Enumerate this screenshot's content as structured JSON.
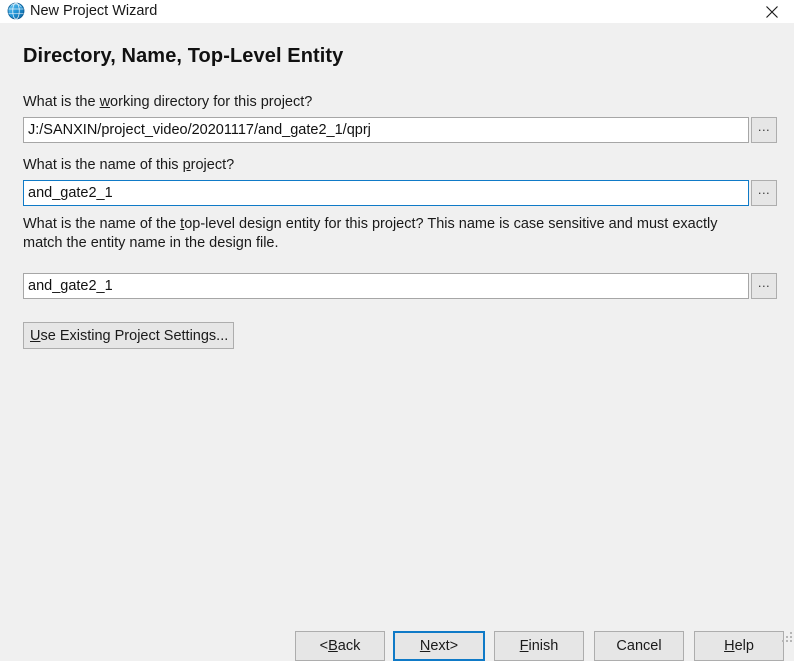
{
  "window": {
    "title": "New Project Wizard",
    "icon": "globe-icon",
    "close_label": "×",
    "accent_color": "#0f7ac7",
    "titlebar_bg": "#ffffff",
    "body_bg": "#f0f0f0"
  },
  "page": {
    "heading": "Directory, Name, Top-Level Entity"
  },
  "fields": {
    "working_directory": {
      "label_before": "What is the ",
      "label_mnemonic": "w",
      "label_after": "orking directory for this project?",
      "value": "J:/SANXIN/project_video/20201117/and_gate2_1/qprj",
      "browse_label": "...",
      "focused": false
    },
    "project_name": {
      "label_before": "What is the name of this ",
      "label_mnemonic": "p",
      "label_after": "roject?",
      "value": "and_gate2_1",
      "browse_label": "...",
      "focused": true
    },
    "top_level_entity": {
      "label_before": "What is the name of the ",
      "label_mnemonic": "t",
      "label_after": "op-level design entity for this project? This name is case sensitive and must exactly",
      "label_line2": "match the entity name in the design file.",
      "value": "and_gate2_1",
      "browse_label": "...",
      "focused": false
    }
  },
  "use_existing": {
    "mnemonic": "U",
    "rest": "se Existing Project Settings..."
  },
  "buttons": [
    {
      "name": "back",
      "prefix": "< ",
      "mnemonic": "B",
      "suffix": "ack",
      "suffix2": "",
      "default": false
    },
    {
      "name": "next",
      "prefix": "",
      "mnemonic": "N",
      "suffix": "ext",
      "suffix2": " >",
      "default": true
    },
    {
      "name": "finish",
      "prefix": "",
      "mnemonic": "F",
      "suffix": "inish",
      "suffix2": "",
      "default": false
    },
    {
      "name": "cancel",
      "prefix": "Cancel",
      "mnemonic": "",
      "suffix": "",
      "suffix2": "",
      "default": false
    },
    {
      "name": "help",
      "prefix": "",
      "mnemonic": "H",
      "suffix": "elp",
      "suffix2": "",
      "default": false
    }
  ]
}
